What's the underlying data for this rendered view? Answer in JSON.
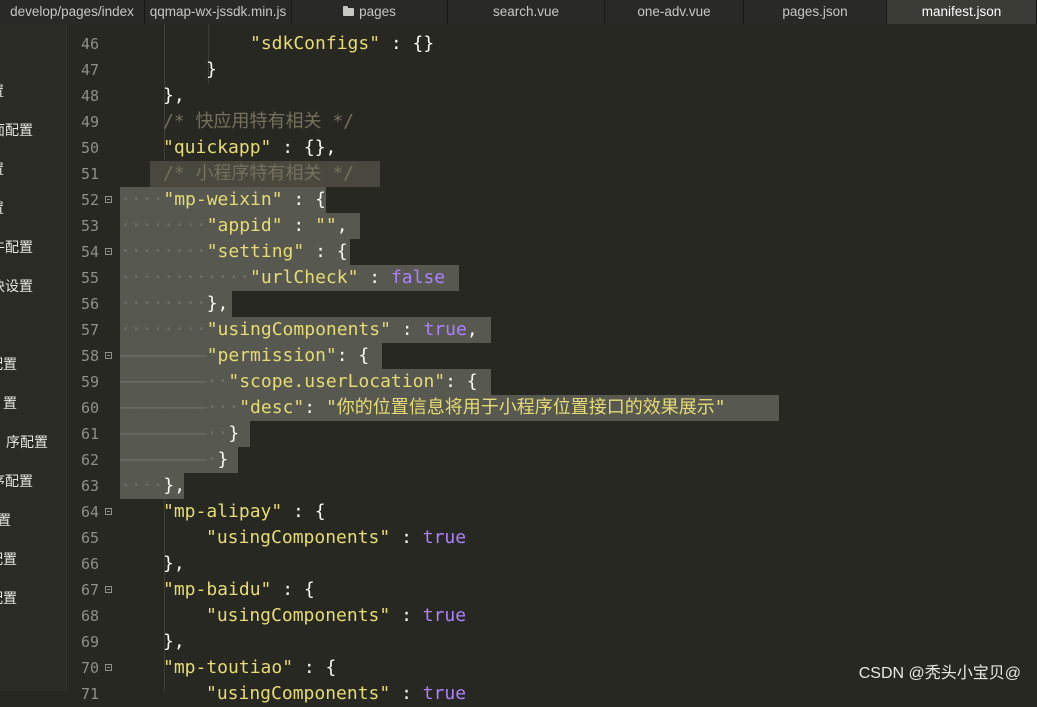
{
  "tabs": [
    {
      "label": "develop/pages/index",
      "active": false,
      "icon": null
    },
    {
      "label": "qqmap-wx-jssdk.min.js",
      "active": false,
      "icon": null
    },
    {
      "label": "pages",
      "active": false,
      "icon": "folder-icon"
    },
    {
      "label": "search.vue",
      "active": false,
      "icon": null
    },
    {
      "label": "one-adv.vue",
      "active": false,
      "icon": null
    },
    {
      "label": "pages.json",
      "active": false,
      "icon": null
    },
    {
      "label": "manifest.json",
      "active": true,
      "icon": null
    }
  ],
  "sidebar": {
    "items": [
      "置",
      "面配置",
      "置",
      "置",
      "牛配置",
      "块设置",
      "配置",
      "置",
      "序配置",
      "序配置",
      "置",
      "配置",
      "配置"
    ]
  },
  "editor": {
    "lines": [
      {
        "n": "46",
        "text": "\"sdkConfigs\" : {}"
      },
      {
        "n": "47",
        "text": "}"
      },
      {
        "n": "48",
        "text": "},"
      },
      {
        "n": "49",
        "text": "/* 快应用特有相关 */"
      },
      {
        "n": "50",
        "text": "\"quickapp\" : {},"
      },
      {
        "n": "51",
        "text": "/* 小程序特有相关 */"
      },
      {
        "n": "52",
        "text": "\"mp-weixin\" : {"
      },
      {
        "n": "53",
        "text": "\"appid\" : \"\","
      },
      {
        "n": "54",
        "text": "\"setting\" : {"
      },
      {
        "n": "55",
        "text": "\"urlCheck\" : false"
      },
      {
        "n": "56",
        "text": "},"
      },
      {
        "n": "57",
        "text": "\"usingComponents\" : true,"
      },
      {
        "n": "58",
        "text": "\"permission\": {"
      },
      {
        "n": "59",
        "text": "\"scope.userLocation\": {"
      },
      {
        "n": "60",
        "text": "\"desc\": \"你的位置信息将用于小程序位置接口的效果展示\""
      },
      {
        "n": "61",
        "text": "}"
      },
      {
        "n": "62",
        "text": "}"
      },
      {
        "n": "63",
        "text": "},"
      },
      {
        "n": "64",
        "text": "\"mp-alipay\" : {"
      },
      {
        "n": "65",
        "text": "\"usingComponents\" : true"
      },
      {
        "n": "66",
        "text": "},"
      },
      {
        "n": "67",
        "text": "\"mp-baidu\" : {"
      },
      {
        "n": "68",
        "text": "\"usingComponents\" : true"
      },
      {
        "n": "69",
        "text": "},"
      },
      {
        "n": "70",
        "text": "\"mp-toutiao\" : {"
      },
      {
        "n": "71",
        "text": "\"usingComponents\" : true"
      }
    ]
  },
  "watermark": "CSDN @秃头小宝贝@",
  "colors": {
    "background": "#272822",
    "string": "#e6db74",
    "comment": "#75715e",
    "boolean": "#ae81ff",
    "selection": "#575850"
  }
}
